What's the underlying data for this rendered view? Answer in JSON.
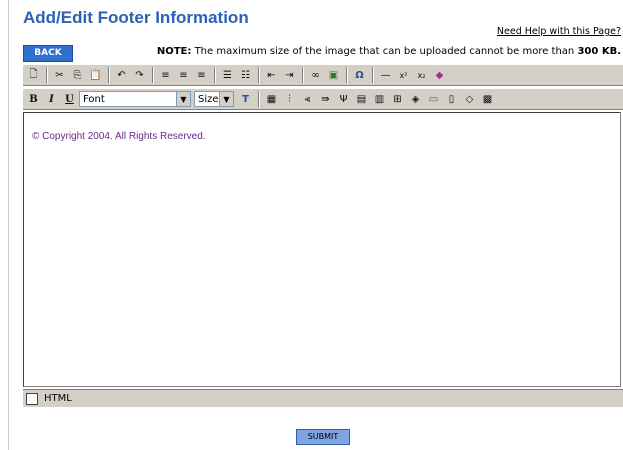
{
  "page": {
    "title": "Add/Edit Footer Information",
    "help_link": "Need Help with this Page?",
    "back_label": "BACK",
    "note_prefix": "NOTE:",
    "note_text": "The maximum size of the image that can be uploaded cannot be more than",
    "note_size": "300 KB."
  },
  "toolbar1": {
    "icons": [
      "new-document-icon",
      "cut-icon",
      "copy-icon",
      "paste-icon",
      "undo-icon",
      "redo-icon",
      "align-left-icon",
      "align-center-icon",
      "align-right-icon",
      "ordered-list-icon",
      "unordered-list-icon",
      "outdent-icon",
      "indent-icon",
      "link-icon",
      "image-icon",
      "special-char-icon",
      "horizontal-rule-icon",
      "superscript-icon",
      "subscript-icon",
      "spellcheck-icon"
    ]
  },
  "toolbar2": {
    "bold": "B",
    "italic": "I",
    "underline": "U",
    "font_select": "Font",
    "size_select": "Size"
  },
  "editor": {
    "content": "© Copyright 2004. All Rights Reserved."
  },
  "footer": {
    "html_label": "HTML",
    "submit_label": "SUBMIT"
  }
}
